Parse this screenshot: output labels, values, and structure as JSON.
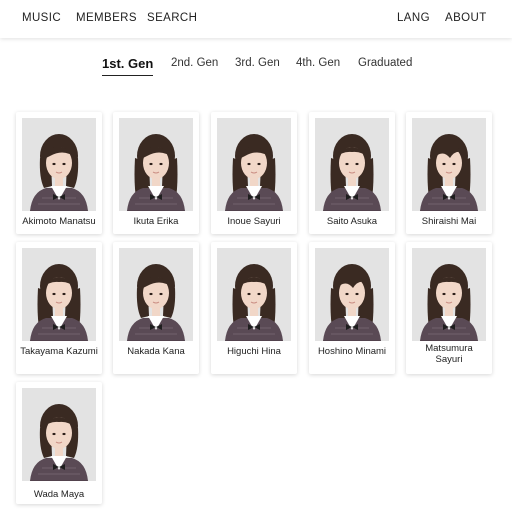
{
  "nav": {
    "left": [
      "MUSIC",
      "MEMBERS",
      "SEARCH"
    ],
    "right": [
      "LANG",
      "ABOUT"
    ]
  },
  "tabs": [
    "1st. Gen",
    "2nd. Gen",
    "3rd. Gen",
    "4th. Gen",
    "Graduated"
  ],
  "active_tab": "1st. Gen",
  "members": [
    {
      "name": "Akimoto Manatsu"
    },
    {
      "name": "Ikuta Erika"
    },
    {
      "name": "Inoue Sayuri"
    },
    {
      "name": "Saito Asuka"
    },
    {
      "name": "Shiraishi Mai"
    },
    {
      "name": "Takayama Kazumi"
    },
    {
      "name": "Nakada Kana"
    },
    {
      "name": "Higuchi Hina"
    },
    {
      "name": "Hoshino Minami"
    },
    {
      "name": "Matsumura Sayuri"
    },
    {
      "name": "Wada Maya"
    }
  ],
  "colors": {
    "photo_background": "#e3e3e3",
    "uniform_plaid": "#5a4a55",
    "collar": "#ffffff",
    "ribbon": "#1e1e1e"
  }
}
